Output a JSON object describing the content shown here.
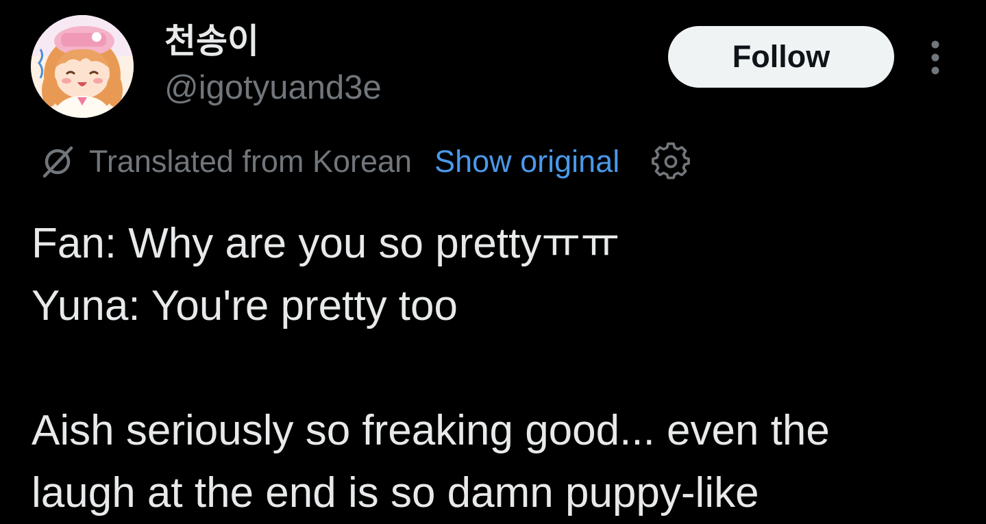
{
  "author": {
    "display_name": "천송이",
    "handle": "@igotyuand3e"
  },
  "actions": {
    "follow_label": "Follow"
  },
  "translation": {
    "label": "Translated from Korean",
    "show_original_label": "Show original"
  },
  "tweet": {
    "lines": [
      "Fan: Why are you so prettyㅠㅠ",
      "Yuna: You're pretty too",
      "",
      "Aish seriously so freaking good... even the",
      "laugh at the end is so damn puppy-like"
    ]
  },
  "colors": {
    "background": "#000000",
    "primary_text": "#e7e9ea",
    "secondary_text": "#71767b",
    "link": "#4a99e9",
    "follow_button_bg": "#eff3f4",
    "follow_button_text": "#0f1419"
  },
  "icons": {
    "avatar": "avatar-image",
    "translate": "translate-icon",
    "settings": "gear-icon",
    "more": "more-options-icon"
  }
}
